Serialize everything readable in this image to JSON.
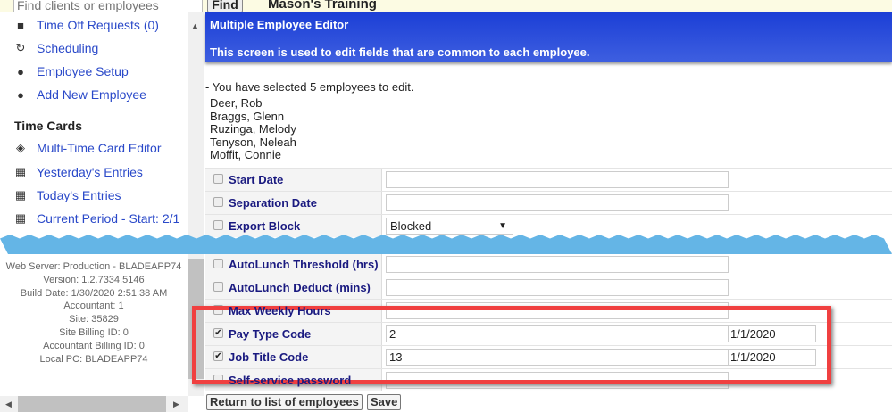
{
  "topbar": {
    "search_placeholder": "Find clients or employees",
    "find_label": "Find",
    "site_title": "Mason's Training"
  },
  "sidebar": {
    "items": [
      {
        "label": "Time Off Requests (0)",
        "icon": "briefcase-icon"
      },
      {
        "label": "Scheduling",
        "icon": "schedule-icon"
      },
      {
        "label": "Employee Setup",
        "icon": "person-icon"
      },
      {
        "label": "Add New Employee",
        "icon": "person-icon"
      }
    ],
    "section": "Time Cards",
    "timecards": [
      {
        "label": "Multi-Time Card Editor",
        "icon": "layers-icon"
      },
      {
        "label": "Yesterday's Entries",
        "icon": "calendar-icon"
      },
      {
        "label": "Today's Entries",
        "icon": "calendar-icon"
      },
      {
        "label": "Current Period - Start: 2/1",
        "icon": "calendar-icon"
      }
    ],
    "info": [
      "Web Server: Production - BLADEAPP74",
      "Version: 1.2.7334.5146",
      "Build Date: 1/30/2020 2:51:38 AM",
      "Accountant: 1",
      "Site: 35829",
      "Site Billing ID: 0",
      "Accountant Billing ID: 0",
      "Local PC: BLADEAPP74"
    ]
  },
  "main": {
    "title": "Multiple Employee Editor",
    "subtitle": "This screen is used to edit fields that are common to each employee.",
    "selected_msg": "- You have selected 5 employees to edit.",
    "employees": [
      "Deer, Rob",
      "Braggs, Glenn",
      "Ruzinga, Melody",
      "Tenyson, Neleah",
      "Moffit, Connie"
    ],
    "fields": [
      {
        "label": "Start Date",
        "checked": false,
        "value": ""
      },
      {
        "label": "Separation Date",
        "checked": false,
        "value": ""
      },
      {
        "label": "Export Block",
        "checked": false,
        "value": "Blocked"
      },
      {
        "label": "AutoLunch Threshold (hrs)",
        "checked": false,
        "value": ""
      },
      {
        "label": "AutoLunch Deduct (mins)",
        "checked": false,
        "value": ""
      },
      {
        "label": "Max Weekly Hours",
        "checked": false,
        "value": ""
      },
      {
        "label": "Pay Type Code",
        "checked": true,
        "value": "2",
        "date": "1/1/2020"
      },
      {
        "label": "Job Title Code",
        "checked": true,
        "value": "13",
        "date": "1/1/2020"
      },
      {
        "label": "Self-service password",
        "checked": false,
        "value": ""
      }
    ],
    "return_label": "Return to list of employees",
    "save_label": "Save"
  },
  "colors": {
    "header": "#1c3fd6",
    "link": "#2a49c9",
    "highlight": "#f04040",
    "tear": "#64b5e6"
  }
}
